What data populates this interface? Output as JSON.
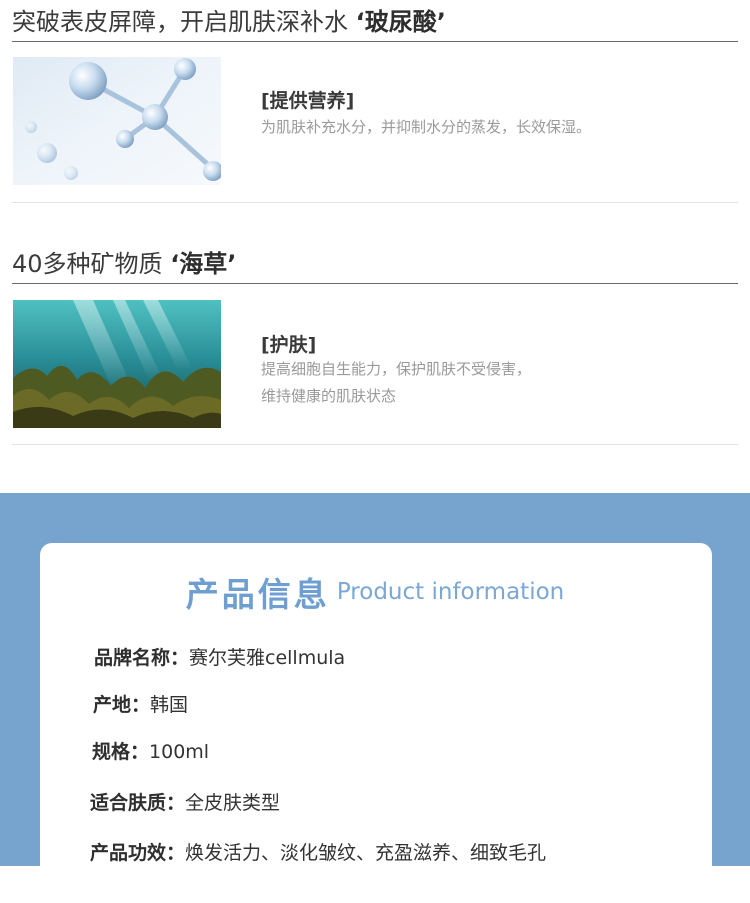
{
  "section1": {
    "heading_prefix": "突破表皮屏障，开启肌肤深补水",
    "heading_highlight": "‘玻尿酸’",
    "image": "molecule-image",
    "feature_title": "[提供营养]",
    "feature_desc": [
      "为肌肤补充水分，并抑制水分的蒸发，长效保湿。"
    ]
  },
  "section2": {
    "heading_prefix": "40多种矿物质",
    "heading_highlight": "‘海草’",
    "image": "seaweed-image",
    "feature_title": "[护肤]",
    "feature_desc": [
      "提高细胞自生能力，保护肌肤不受侵害，",
      "维持健康的肌肤状态"
    ]
  },
  "product_info": {
    "title_cn": "产品信息",
    "title_en": "Product information",
    "rows": [
      {
        "label": "品牌名称：",
        "value": "赛尔芙雅cellmula"
      },
      {
        "label": "产地：",
        "value": "韩国"
      },
      {
        "label": "规格：",
        "value": "100ml"
      },
      {
        "label": "适合肤质：",
        "value": "全皮肤类型"
      },
      {
        "label": "产品功效：",
        "value": "焕发活力、淡化皱纹、充盈滋养、细致毛孔"
      }
    ]
  },
  "colors": {
    "band": "#77a3cf",
    "title_blue": "#6f9fd0"
  }
}
